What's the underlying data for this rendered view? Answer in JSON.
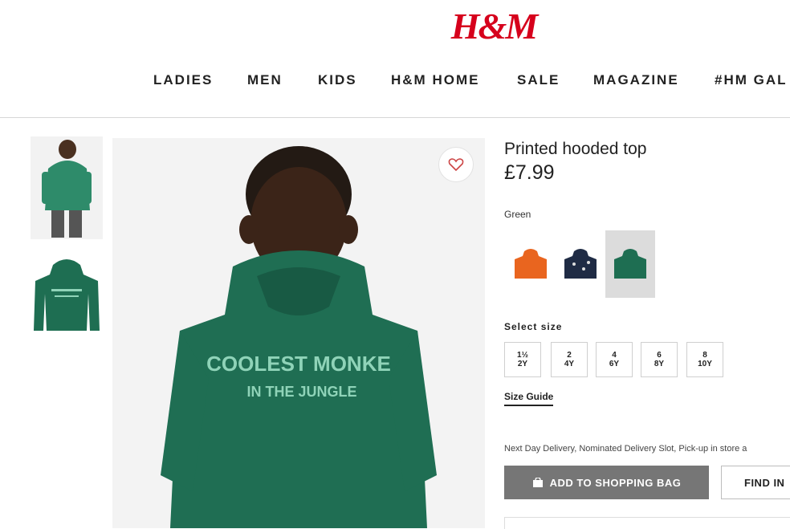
{
  "header": {
    "logo_text": "H&M",
    "logo_color": "#d6001c",
    "nav": [
      "LADIES",
      "MEN",
      "KIDS",
      "H&M HOME",
      "SALE",
      "MAGAZINE",
      "#HM GAL"
    ]
  },
  "gallery": {
    "hoodie_print": [
      "COOLEST MONKE",
      "IN THE JUNGLE"
    ]
  },
  "product": {
    "name": "Printed hooded top",
    "price": "£7.99",
    "selected_color": "Green",
    "swatch_colors": [
      "#e9651f",
      "#1f2b44",
      "#1e6e52"
    ],
    "size_label": "Select size",
    "sizes": [
      {
        "top": "1½",
        "bottom": "2Y"
      },
      {
        "top": "2",
        "bottom": "4Y"
      },
      {
        "top": "4",
        "bottom": "6Y"
      },
      {
        "top": "6",
        "bottom": "8Y"
      },
      {
        "top": "8",
        "bottom": "10Y"
      }
    ],
    "size_guide": "Size Guide",
    "delivery": "Next Day Delivery, Nominated Delivery Slot, Pick-up in store a",
    "add_to_bag": "ADD TO SHOPPING BAG",
    "find_in_store": "FIND IN"
  }
}
